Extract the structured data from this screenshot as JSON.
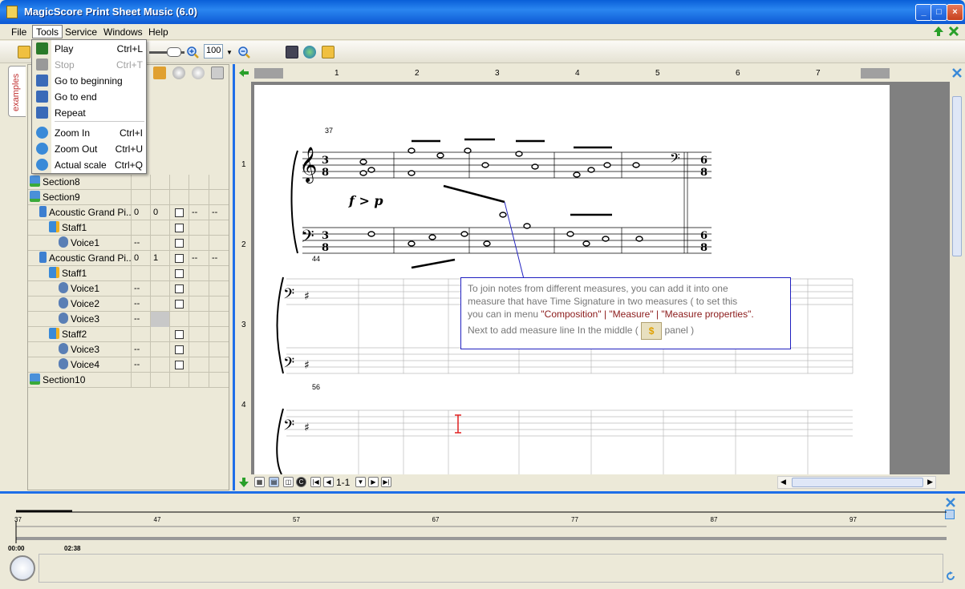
{
  "window": {
    "title": "MagicScore Print Sheet Music (6.0)",
    "min_label": "_",
    "max_label": "□",
    "close_label": "×"
  },
  "menubar": {
    "items": [
      "File",
      "Tools",
      "Service",
      "Windows",
      "Help"
    ]
  },
  "toolbar": {
    "zoom_value": "100"
  },
  "sidebar": {
    "tab_label": "examples"
  },
  "tools_menu": {
    "items": [
      {
        "label": "Play",
        "shortcut": "Ctrl+L",
        "enabled": true,
        "icon": "play-icon"
      },
      {
        "label": "Stop",
        "shortcut": "Ctrl+T",
        "enabled": false,
        "icon": "stop-icon"
      },
      {
        "label": "Go to beginning",
        "shortcut": "",
        "enabled": true,
        "icon": "go-to-beginning-icon"
      },
      {
        "label": "Go to end",
        "shortcut": "",
        "enabled": true,
        "icon": "go-to-end-icon"
      },
      {
        "label": "Repeat",
        "shortcut": "",
        "enabled": true,
        "icon": "repeat-icon"
      },
      {
        "label": "Zoom In",
        "shortcut": "Ctrl+I",
        "enabled": true,
        "icon": "zoom-in-icon"
      },
      {
        "label": "Zoom Out",
        "shortcut": "Ctrl+U",
        "enabled": true,
        "icon": "zoom-out-icon"
      },
      {
        "label": "Actual scale",
        "shortcut": "Ctrl+Q",
        "enabled": true,
        "icon": "actual-scale-icon"
      }
    ]
  },
  "tree": {
    "rows": [
      {
        "name": "Section8",
        "indent": 0,
        "type": "section",
        "c1": "",
        "c2": "",
        "c3": false,
        "c4": "",
        "c5": ""
      },
      {
        "name": "Section9",
        "indent": 0,
        "type": "section",
        "c1": "",
        "c2": "",
        "c3": false,
        "c4": "",
        "c5": ""
      },
      {
        "name": "Acoustic Grand Pi...",
        "indent": 1,
        "type": "instrument",
        "c1": "0",
        "c2": "0",
        "c3": true,
        "c4": "--",
        "c5": "--"
      },
      {
        "name": "Staff1",
        "indent": 2,
        "type": "staff",
        "c1": "",
        "c2": "",
        "c3": true,
        "c4": "",
        "c5": ""
      },
      {
        "name": "Voice1",
        "indent": 3,
        "type": "voice",
        "c1": "--",
        "c2": "",
        "c3": true,
        "c4": "",
        "c5": ""
      },
      {
        "name": "Acoustic Grand Pi...",
        "indent": 1,
        "type": "instrument",
        "c1": "0",
        "c2": "1",
        "c3": true,
        "c4": "--",
        "c5": "--"
      },
      {
        "name": "Staff1",
        "indent": 2,
        "type": "staff",
        "c1": "",
        "c2": "",
        "c3": true,
        "c4": "",
        "c5": ""
      },
      {
        "name": "Voice1",
        "indent": 3,
        "type": "voice",
        "c1": "--",
        "c2": "",
        "c3": true,
        "c4": "",
        "c5": ""
      },
      {
        "name": "Voice2",
        "indent": 3,
        "type": "voice",
        "c1": "--",
        "c2": "",
        "c3": true,
        "c4": "",
        "c5": ""
      },
      {
        "name": "Voice3",
        "indent": 3,
        "type": "voice",
        "c1": "--",
        "c2": "gray",
        "c3": false,
        "c4": "",
        "c5": ""
      },
      {
        "name": "Staff2",
        "indent": 2,
        "type": "staff",
        "c1": "",
        "c2": "",
        "c3": true,
        "c4": "",
        "c5": ""
      },
      {
        "name": "Voice3",
        "indent": 3,
        "type": "voice",
        "c1": "--",
        "c2": "",
        "c3": true,
        "c4": "",
        "c5": ""
      },
      {
        "name": "Voice4",
        "indent": 3,
        "type": "voice",
        "c1": "--",
        "c2": "",
        "c3": true,
        "c4": "",
        "c5": ""
      },
      {
        "name": "Section10",
        "indent": 0,
        "type": "section",
        "c1": "",
        "c2": "",
        "c3": false,
        "c4": "",
        "c5": ""
      }
    ]
  },
  "score": {
    "ruler_numbers": [
      "1",
      "2",
      "3",
      "4",
      "5",
      "6",
      "7"
    ],
    "left_ruler_numbers": [
      "1",
      "2",
      "3",
      "4"
    ],
    "measure_numbers": [
      "37",
      "44",
      "56"
    ],
    "dynamics": "f > p",
    "time_sig_a": "3\n8",
    "time_sig_b": "6\n8",
    "page_indicator": "1-1"
  },
  "callout": {
    "line1": "To join notes from different measures, you can add it into one",
    "line2": "measure that have Time Signature in two measures ( to set this",
    "line3_prefix": "you can in menu ",
    "line3_h1": "\"Composition\"",
    "line3_sep1": " | ",
    "line3_h2": "\"Measure\"",
    "line3_sep2": " | ",
    "line3_h3": "\"Measure properties\"",
    "line3_suffix": ".",
    "line4_prefix": "Next to add measure line In the middle (",
    "line4_suffix": "panel )"
  },
  "timeline": {
    "ticks": [
      "37",
      "47",
      "57",
      "67",
      "77",
      "87",
      "97",
      "97"
    ],
    "time_start": "00:00",
    "time_end": "02:38"
  }
}
